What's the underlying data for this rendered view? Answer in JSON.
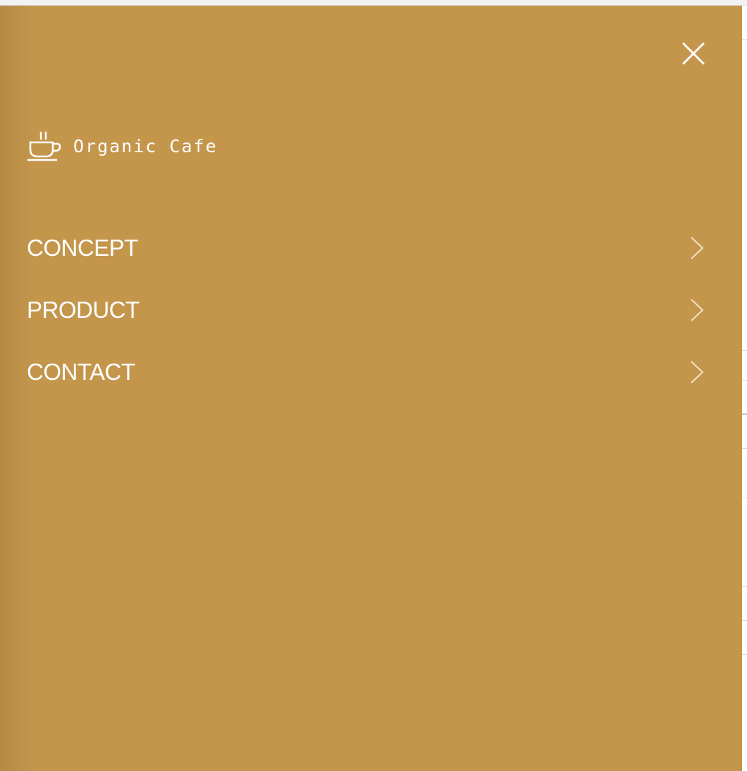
{
  "colors": {
    "drawer_bg": "#c4964c",
    "text": "#ffffff",
    "chevron": "#f3e3c6"
  },
  "drawer": {
    "close_icon": "close-icon",
    "brand": {
      "icon": "coffee-cup-icon",
      "name": "Organic Cafe"
    },
    "menu": [
      {
        "label": "CONCEPT",
        "icon": "chevron-right-icon"
      },
      {
        "label": "PRODUCT",
        "icon": "chevron-right-icon"
      },
      {
        "label": "CONTACT",
        "icon": "chevron-right-icon"
      }
    ]
  }
}
